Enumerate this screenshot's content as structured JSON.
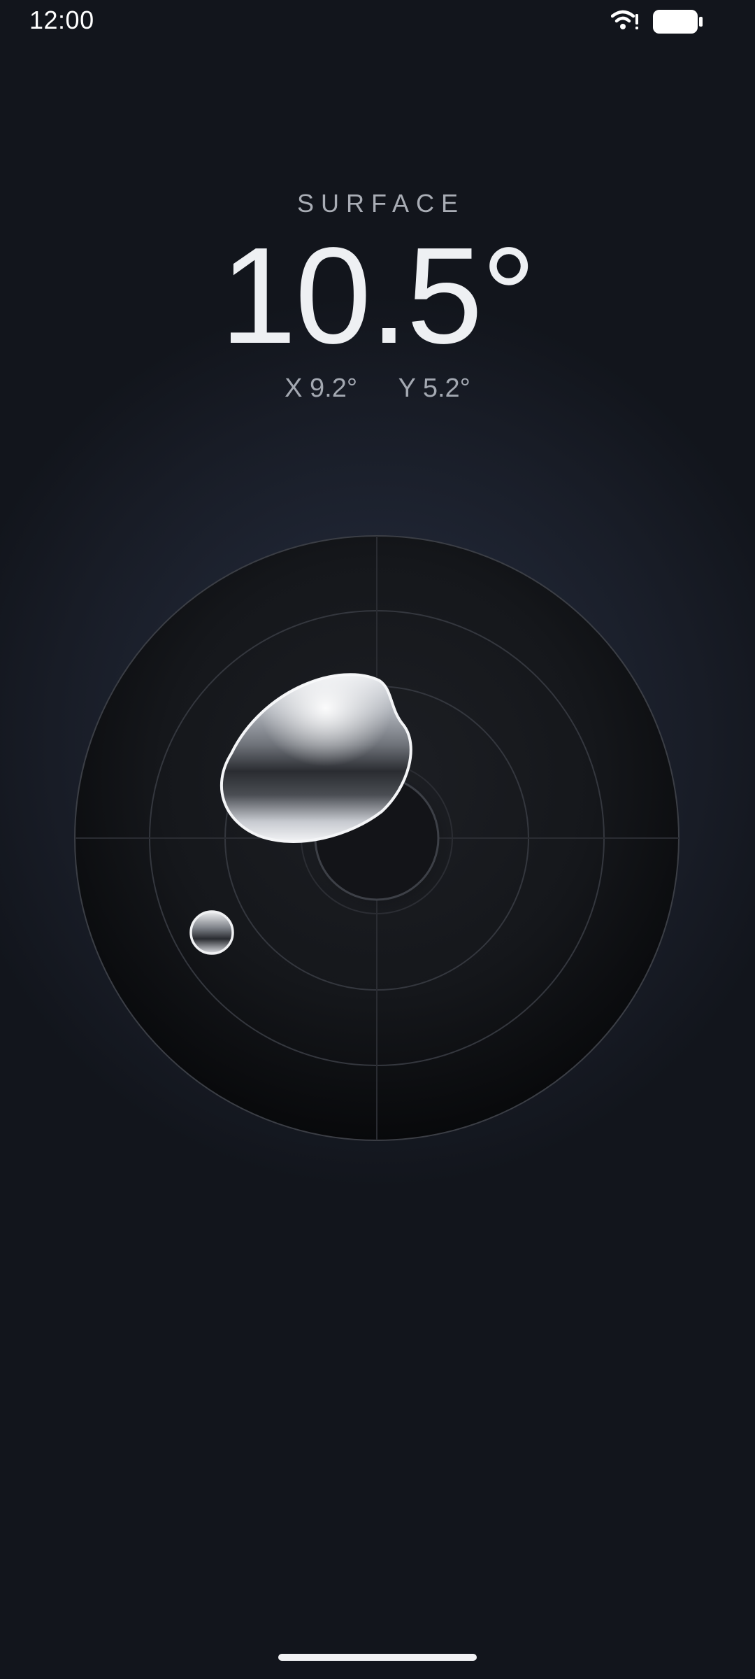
{
  "status_bar": {
    "time": "12:00",
    "icons": [
      "wifi-alert-icon",
      "battery-icon"
    ]
  },
  "readout": {
    "surface_label": "SURFACE",
    "angle": "10.5°",
    "x_label": "X 9.2°",
    "y_label": "Y 5.2°"
  },
  "level": {
    "tilt_x_deg": 9.2,
    "tilt_y_deg": 5.2,
    "colors": {
      "dial": "#101115",
      "ring": "#3a3d44",
      "bubble_highlight": "#ffffff"
    }
  }
}
